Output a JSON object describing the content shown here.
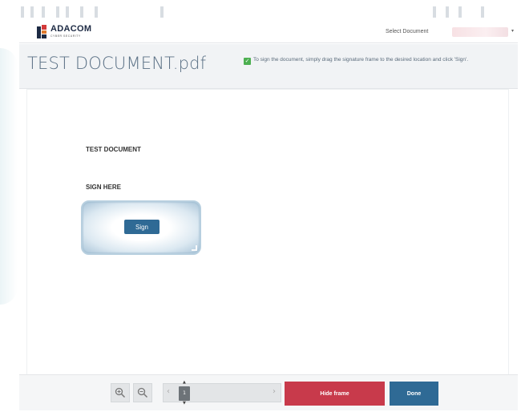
{
  "brand": {
    "name": "ADACOM",
    "tagline": "CYBER SECURITY"
  },
  "topbar": {
    "select_document_label": "Select Document",
    "select_document_value": "",
    "caret": "▾"
  },
  "header": {
    "document_title": "TEST DOCUMENT.pdf",
    "instruction": "To sign the document, simply drag the signature frame to the desired location and click 'Sign'."
  },
  "document": {
    "heading": "TEST DOCUMENT",
    "sign_here": "SIGN HERE",
    "sign_button": "Sign"
  },
  "footer": {
    "zoom_in_icon": "zoom-in",
    "zoom_out_icon": "zoom-out",
    "page_prev": "‹",
    "page_next": "›",
    "current_page": "1",
    "hide_frame_button": "Hide frame",
    "done_button": "Done"
  },
  "colors": {
    "accent": "#2f6a95",
    "danger": "#c83a4b",
    "title": "#5a7085",
    "check": "#4caf50"
  }
}
